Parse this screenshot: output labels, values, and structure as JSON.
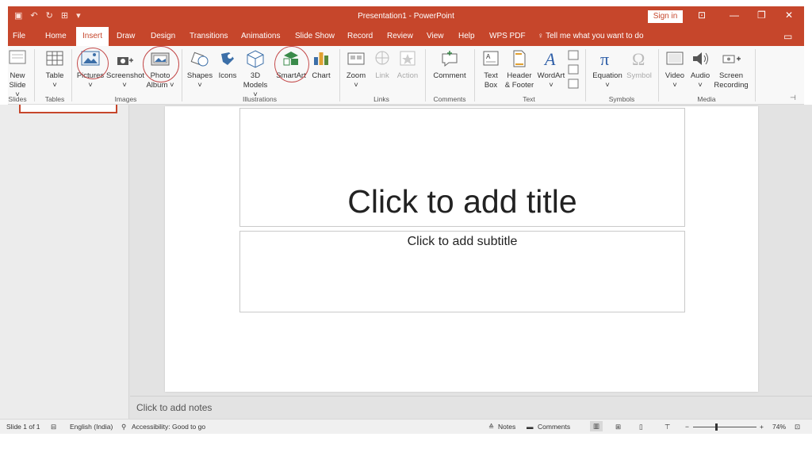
{
  "window": {
    "title": "Presentation1 - PowerPoint",
    "sign_in": "Sign in"
  },
  "tabs": [
    "File",
    "Home",
    "Insert",
    "Draw",
    "Design",
    "Transitions",
    "Animations",
    "Slide Show",
    "Record",
    "Review",
    "View",
    "Help",
    "WPS PDF"
  ],
  "active_tab": "Insert",
  "tell_me": "Tell me what you want to do",
  "ribbon": {
    "new_slide": [
      "New",
      "Slide ˅"
    ],
    "table": [
      "Table",
      "˅"
    ],
    "pictures": [
      "Pictures",
      "˅"
    ],
    "screenshot": [
      "Screenshot",
      "˅"
    ],
    "photo_album": [
      "Photo",
      "Album ˅"
    ],
    "shapes": [
      "Shapes",
      "˅"
    ],
    "icons": [
      "Icons"
    ],
    "models_3d": [
      "3D",
      "Models ˅"
    ],
    "smartart": [
      "SmartArt"
    ],
    "chart": [
      "Chart"
    ],
    "zoom": [
      "Zoom",
      "˅"
    ],
    "link": [
      "Link"
    ],
    "action": [
      "Action"
    ],
    "comment": [
      "Comment"
    ],
    "text_box": [
      "Text",
      "Box"
    ],
    "header_footer": [
      "Header",
      "& Footer"
    ],
    "wordart": [
      "WordArt",
      "˅"
    ],
    "equation": [
      "Equation",
      "˅"
    ],
    "symbol": [
      "Symbol"
    ],
    "video": [
      "Video",
      "˅"
    ],
    "audio": [
      "Audio",
      "˅"
    ],
    "screen_recording": [
      "Screen",
      "Recording"
    ],
    "groups": {
      "slides": "Slides",
      "tables": "Tables",
      "images": "Images",
      "illustrations": "Illustrations",
      "links": "Links",
      "comments": "Comments",
      "text": "Text",
      "symbols": "Symbols",
      "media": "Media"
    }
  },
  "slide": {
    "title_placeholder": "Click to add title",
    "subtitle_placeholder": "Click to add subtitle"
  },
  "notes_placeholder": "Click to add notes",
  "status": {
    "slide_counter": "Slide 1 of 1",
    "language": "English (India)",
    "accessibility": "Accessibility: Good to go",
    "notes": "Notes",
    "comments": "Comments",
    "zoom_minus": "−",
    "zoom_plus": "+",
    "zoom_level": "74%",
    "zoom_fraction": 0.74
  },
  "colors": {
    "accent": "#c6462b",
    "ribbon_bg": "#f8f8f8",
    "highlight_circle": "#c44a4a"
  }
}
